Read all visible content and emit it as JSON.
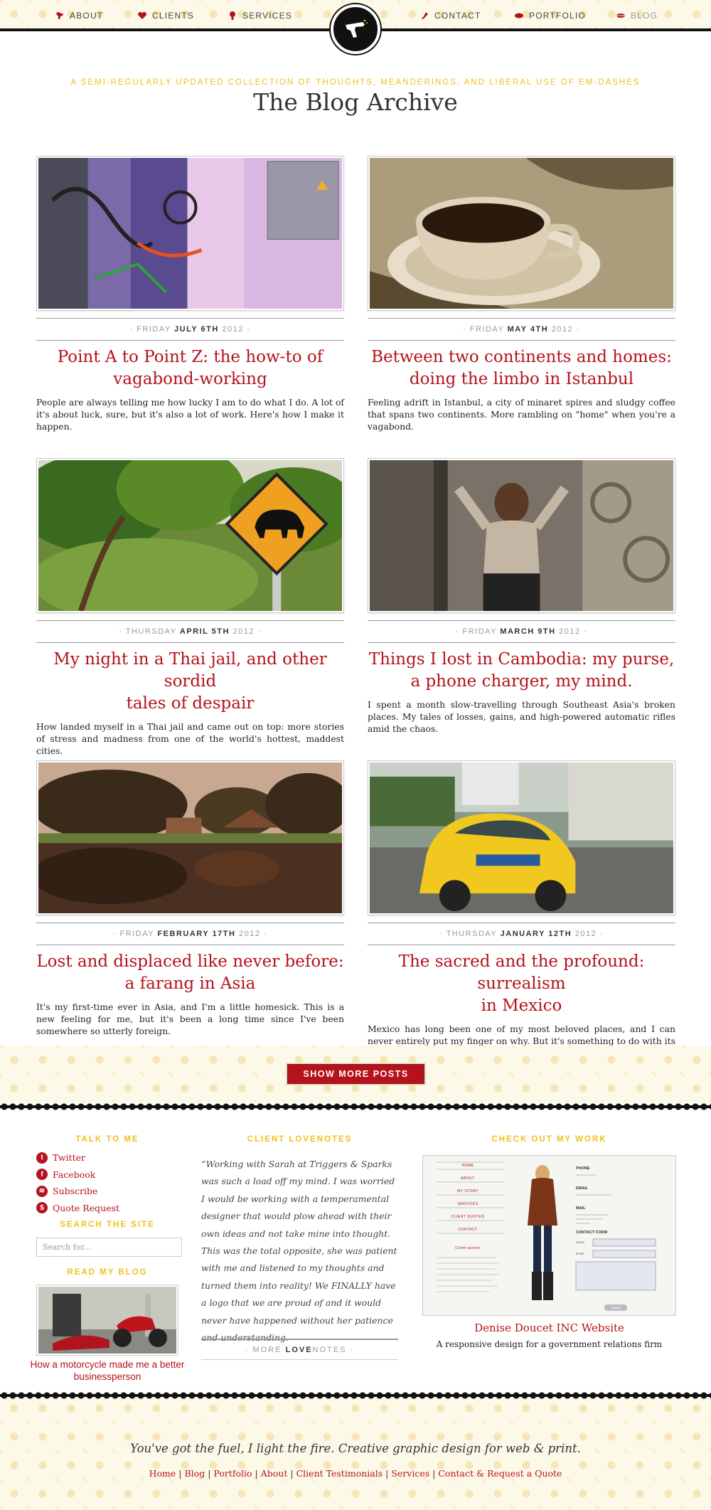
{
  "nav": {
    "items": [
      {
        "label": "ABOUT",
        "icon": "dinosaur-icon"
      },
      {
        "label": "CLIENTS",
        "icon": "heart-icon"
      },
      {
        "label": "SERVICES",
        "icon": "lightbulb-icon"
      },
      {
        "label": "CONTACT",
        "icon": "lipstick-icon"
      },
      {
        "label": "PORTFOLIO",
        "icon": "lips-icon"
      },
      {
        "label": "BLOG",
        "icon": "kiss-icon"
      }
    ],
    "active": "BLOG"
  },
  "header": {
    "tagline": "A SEMI-REGULARLY UPDATED COLLECTION OF THOUGHTS, MEANDERINGS, AND LIBERAL USE OF EM-DASHES",
    "title": "The Blog Archive"
  },
  "posts": [
    {
      "weekday": "FRIDAY",
      "date": "JULY 6TH",
      "year": "2012",
      "title_line1": "Point A to Point Z: the how-to of",
      "title_line2": "vagabond-working",
      "excerpt": "People are always telling me how lucky I am to do what I do. A lot of it's about luck, sure, but it's also a lot of work. Here's how I make it happen."
    },
    {
      "weekday": "FRIDAY",
      "date": "MAY 4TH",
      "year": "2012",
      "title_line1": "Between two continents and homes:",
      "title_line2": "doing the limbo in Istanbul",
      "excerpt": "Feeling adrift in Istanbul, a city of minaret spires and sludgy coffee that spans two continents. More rambling on \"home\" when you're a vagabond."
    },
    {
      "weekday": "THURSDAY",
      "date": "APRIL 5TH",
      "year": "2012",
      "title_line1": "My night in a Thai jail, and other sordid",
      "title_line2": "tales of despair",
      "excerpt": "How landed myself in a Thai jail and came out on top: more stories of stress and madness from one of the world's hottest, maddest cities."
    },
    {
      "weekday": "FRIDAY",
      "date": "MARCH 9TH",
      "year": "2012",
      "title_line1": "Things I lost in Cambodia: my purse,",
      "title_line2": "a phone charger, my mind.",
      "excerpt": "I spent a month slow-travelling through Southeast Asia's broken places. My tales of losses, gains, and high-powered automatic rifles amid the chaos."
    },
    {
      "weekday": "FRIDAY",
      "date": "FEBRUARY 17TH",
      "year": "2012",
      "title_line1": "Lost and displaced like never before:",
      "title_line2": "a farang in Asia",
      "excerpt": "It's my first-time ever in Asia, and I'm a little homesick. This is a new feeling for me, but it's been a long time since I've been somewhere so utterly foreign."
    },
    {
      "weekday": "THURSDAY",
      "date": "JANUARY 12TH",
      "year": "2012",
      "title_line1": "The sacred and the profound: surrealism",
      "title_line2": "in Mexico",
      "excerpt": "Mexico has long been one of my most beloved places, and I can never entirely put my finger on why. But it's something to do with its colour and vibrancy."
    }
  ],
  "show_more_label": "SHOW MORE POSTS",
  "footer": {
    "talk_heading": "TALK TO ME",
    "social": [
      {
        "label": "Twitter",
        "glyph": "t"
      },
      {
        "label": "Facebook",
        "glyph": "f"
      },
      {
        "label": "Subscribe",
        "glyph": "≋"
      },
      {
        "label": "Quote Request",
        "glyph": "$"
      }
    ],
    "search_heading": "SEARCH THE SITE",
    "search_placeholder": "Search for...",
    "blog_heading": "READ MY BLOG",
    "blog_caption": "How a motorcycle made me a better businessperson",
    "lovenotes_heading": "CLIENT LOVENOTES",
    "quote": "“Working with Sarah at Triggers & Sparks was such a load off my mind. I was worried I would be working with a temperamental designer that would plow ahead with their own ideas and not take mine into thought. This was the total opposite, she was patient with me and listened to my thoughts and turned them into reality! We FINALLY have a logo that we are proud of and it would never have happened without her patience and understanding.",
    "more_prefix": "· MORE ",
    "more_bold": "LOVE",
    "more_suffix": "NOTES ·",
    "work_heading": "CHECK OUT MY WORK",
    "work_title": "Denise Doucet INC Website",
    "work_subtitle": "A responsive design for a government relations firm",
    "work_mock": {
      "menu": [
        "HOME",
        "ABOUT",
        "MY STORY",
        "SERVICES",
        "CLIENT QUOTES",
        "CONTACT"
      ],
      "client_quotes": "Client quotes",
      "phone_label": "PHONE",
      "email_label": "EMAIL",
      "mail_label": "MAIL",
      "form_label": "CONTACT FORM",
      "name_label": "Name",
      "email_field_label": "Email",
      "submit": "Submit"
    }
  },
  "bottom": {
    "slogan": "You've got the fuel, I light the fire. Creative graphic design for web & print.",
    "links": [
      "Home",
      "Blog",
      "Portfolio",
      "About",
      "Client Testimonials",
      "Services",
      "Contact & Request a Quote"
    ]
  },
  "colors": {
    "accent": "#b5121b",
    "gold": "#f0c018",
    "ink": "#111111"
  }
}
